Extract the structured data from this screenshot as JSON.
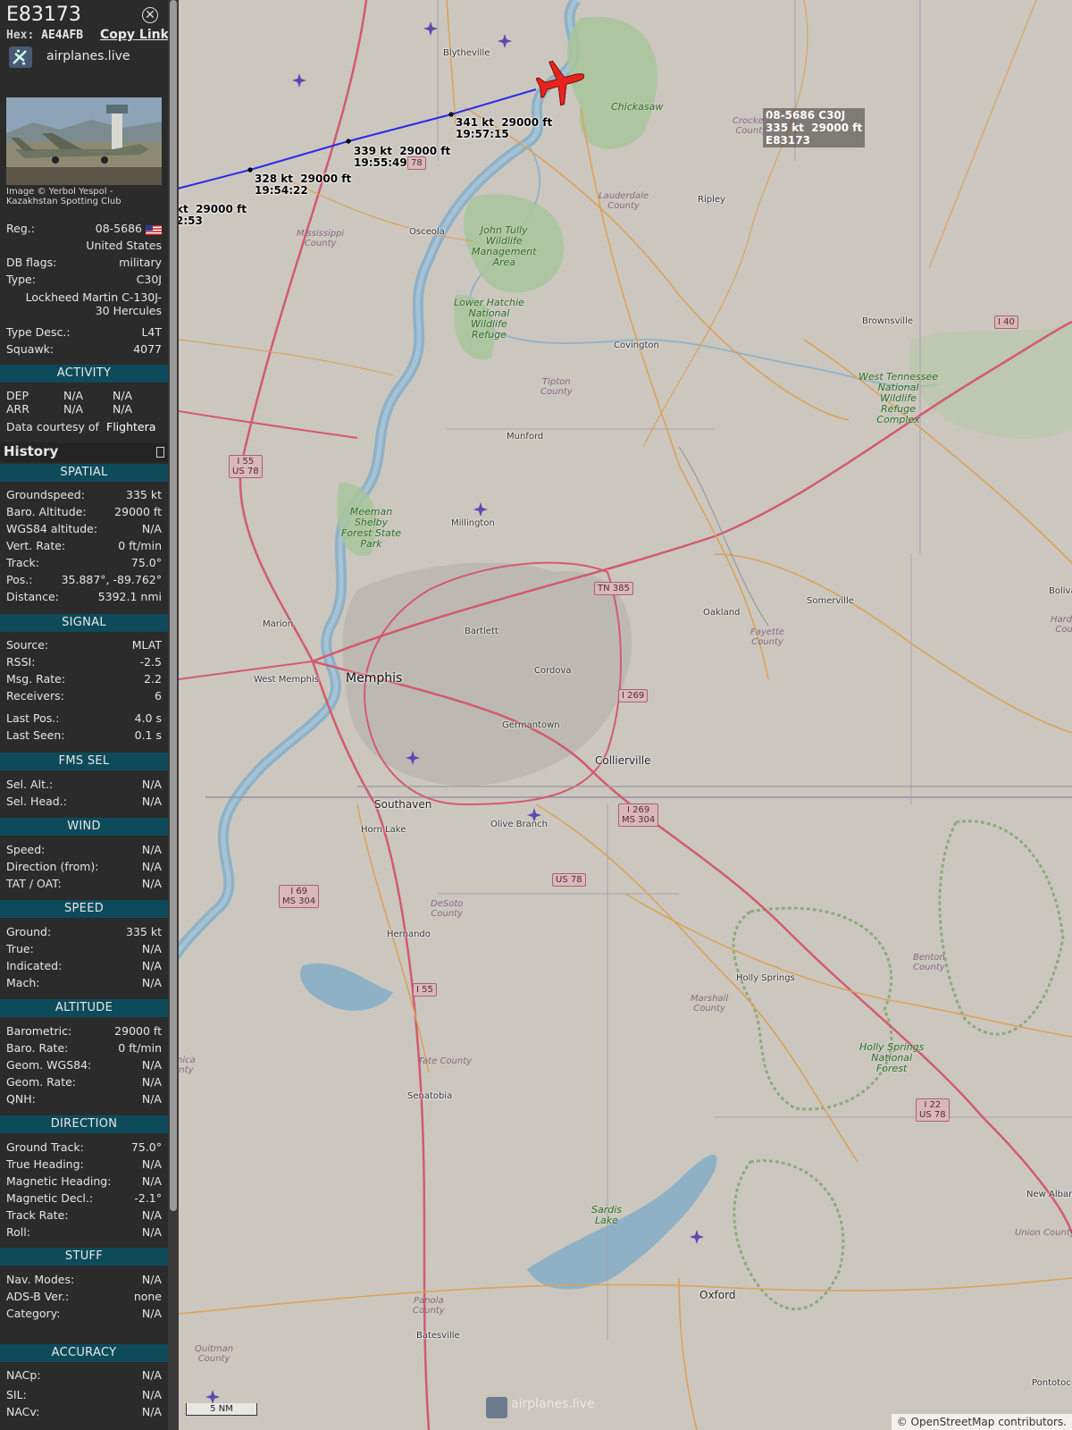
{
  "header": {
    "callsign": "E83173",
    "hex_label": "Hex:",
    "hex": "AE4AFB",
    "copy_link": "Copy Link",
    "brand": "airplanes.live"
  },
  "photo": {
    "credit": "Image © Yerbol Yespol - Kazakhstan Spotting Club"
  },
  "details": {
    "reg_label": "Reg.:",
    "reg": "08-5686",
    "country": "United States",
    "dbflags_label": "DB flags:",
    "dbflags": "military",
    "type_label": "Type:",
    "type": "C30J",
    "type_full": "Lockheed Martin C-130J-30 Hercules",
    "typedesc_label": "Type Desc.:",
    "typedesc": "L4T",
    "squawk_label": "Squawk:",
    "squawk": "4077"
  },
  "activity": {
    "title": "ACTIVITY",
    "dep": "DEP",
    "arr": "ARR",
    "na": "N/A",
    "courtesy": "Data courtesy of",
    "courtesy_src": "Flightera"
  },
  "history_title": "History",
  "sections": {
    "spatial": "SPATIAL",
    "signal": "SIGNAL",
    "fms": "FMS SEL",
    "wind": "WIND",
    "speed": "SPEED",
    "altitude": "ALTITUDE",
    "direction": "DIRECTION",
    "stuff": "STUFF",
    "accuracy": "ACCURACY"
  },
  "spatial": [
    {
      "k": "Groundspeed:",
      "v": "335 kt"
    },
    {
      "k": "Baro. Altitude:",
      "v": "29000 ft"
    },
    {
      "k": "WGS84 altitude:",
      "v": "N/A"
    },
    {
      "k": "Vert. Rate:",
      "v": "0 ft/min"
    },
    {
      "k": "Track:",
      "v": "75.0°"
    },
    {
      "k": "Pos.:",
      "v": "35.887°, -89.762°"
    },
    {
      "k": "Distance:",
      "v": "5392.1 nmi"
    }
  ],
  "signal": [
    {
      "k": "Source:",
      "v": "MLAT"
    },
    {
      "k": "RSSI:",
      "v": "-2.5"
    },
    {
      "k": "Msg. Rate:",
      "v": "2.2"
    },
    {
      "k": "Receivers:",
      "v": "6"
    },
    {
      "k": "Last Pos.:",
      "v": "4.0 s"
    },
    {
      "k": "Last Seen:",
      "v": "0.1 s"
    }
  ],
  "fms": [
    {
      "k": "Sel. Alt.:",
      "v": "N/A"
    },
    {
      "k": "Sel. Head.:",
      "v": "N/A"
    }
  ],
  "wind": [
    {
      "k": "Speed:",
      "v": "N/A"
    },
    {
      "k": "Direction (from):",
      "v": "N/A"
    },
    {
      "k": "TAT / OAT:",
      "v": "N/A"
    }
  ],
  "speed": [
    {
      "k": "Ground:",
      "v": "335 kt"
    },
    {
      "k": "True:",
      "v": "N/A"
    },
    {
      "k": "Indicated:",
      "v": "N/A"
    },
    {
      "k": "Mach:",
      "v": "N/A"
    }
  ],
  "altitude": [
    {
      "k": "Barometric:",
      "v": "29000 ft"
    },
    {
      "k": "Baro. Rate:",
      "v": "0 ft/min"
    },
    {
      "k": "Geom. WGS84:",
      "v": "N/A"
    },
    {
      "k": "Geom. Rate:",
      "v": "N/A"
    },
    {
      "k": "QNH:",
      "v": "N/A"
    }
  ],
  "direction": [
    {
      "k": "Ground Track:",
      "v": "75.0°"
    },
    {
      "k": "True Heading:",
      "v": "N/A"
    },
    {
      "k": "Magnetic Heading:",
      "v": "N/A"
    },
    {
      "k": "Magnetic Decl.:",
      "v": "-2.1°"
    },
    {
      "k": "Track Rate:",
      "v": "N/A"
    },
    {
      "k": "Roll:",
      "v": "N/A"
    }
  ],
  "stuff": [
    {
      "k": "Nav. Modes:",
      "v": "N/A"
    },
    {
      "k": "ADS-B Ver.:",
      "v": "none"
    },
    {
      "k": "Category:",
      "v": "N/A"
    }
  ],
  "accuracy": [
    {
      "k": "NACp:",
      "v": "N/A"
    },
    {
      "k": "SIL:",
      "v": "N/A"
    },
    {
      "k": "NACv:",
      "v": "N/A"
    }
  ],
  "map": {
    "track_labels": [
      "kt  29000 ft\n2:53",
      "328 kt  29000 ft\n19:54:22",
      "339 kt  29000 ft\n19:55:49",
      "341 kt  29000 ft\n19:57:15"
    ],
    "plane_label": "08-5686 C30J\n335 kt  29000 ft\nE83173",
    "plane_color": "#e8231e",
    "track_color": "#2a2ae8",
    "cities": {
      "memphis": "Memphis",
      "west_memphis": "West Memphis",
      "marion": "Marion",
      "bartlett": "Bartlett",
      "cordova": "Cordova",
      "germantown": "Germantown",
      "collierville": "Collierville",
      "southaven": "Southaven",
      "horn_lake": "Horn Lake",
      "olive_branch": "Olive Branch",
      "hernando": "Hernando",
      "senatobia": "Senatobia",
      "batesville": "Batesville",
      "oxford": "Oxford",
      "holly_springs": "Holly Springs",
      "new_albany": "New Albany",
      "pontotoc": "Pontotoc",
      "oakland": "Oakland",
      "somerville": "Somerville",
      "bolivar": "Boliva",
      "brownsville": "Brownsville",
      "covington": "Covington",
      "munford": "Munford",
      "millington": "Millington",
      "ripley": "Ripley",
      "blytheville": "Blytheville",
      "osceola": "Osceola"
    },
    "counties": {
      "crockett": "Crockett\nCounty",
      "lauderdale": "Lauderdale\nCounty",
      "mississippi": "Mississippi\nCounty",
      "tipton": "Tipton\nCounty",
      "fayette": "Fayette\nCounty",
      "hardeman": "Harden\nCoun",
      "desoto": "DeSoto\nCounty",
      "marshall": "Marshall\nCounty",
      "benton": "Benton\nCounty",
      "tate": "Tate County",
      "panola": "Panola\nCounty",
      "quitman": "Quitman\nCounty",
      "union": "Union County",
      "tunica": "nica\nnty"
    },
    "parks": {
      "john_tully": "John Tully\nWildlife\nManagement\nArea",
      "lower_hatchie": "Lower Hatchie\nNational\nWildlife\nRefuge",
      "west_tn": "West Tennessee\nNational\nWildlife\nRefuge\nComplex",
      "meeman": "Meeman\nShelby\nForest State\nPark",
      "holly_springs_nf": "Holly Springs\nNational\nForest",
      "sardis": "Sardis\nLake",
      "chickasaw": "Chickasaw"
    },
    "shields": {
      "i55_us78": "I 55\nUS 78",
      "tn385": "TN 385",
      "i269": "I 269",
      "i269_ms304": "I 269\nMS 304",
      "us78": "US 78",
      "i69_ms304": "I 69\nMS 304",
      "i55": "I 55",
      "i22_us78": "I 22\nUS 78",
      "i40": "I 40",
      "partial78": "78"
    },
    "scale": "5 NM",
    "attribution": "© OpenStreetMap contributors.",
    "watermark": "airplanes.live"
  }
}
